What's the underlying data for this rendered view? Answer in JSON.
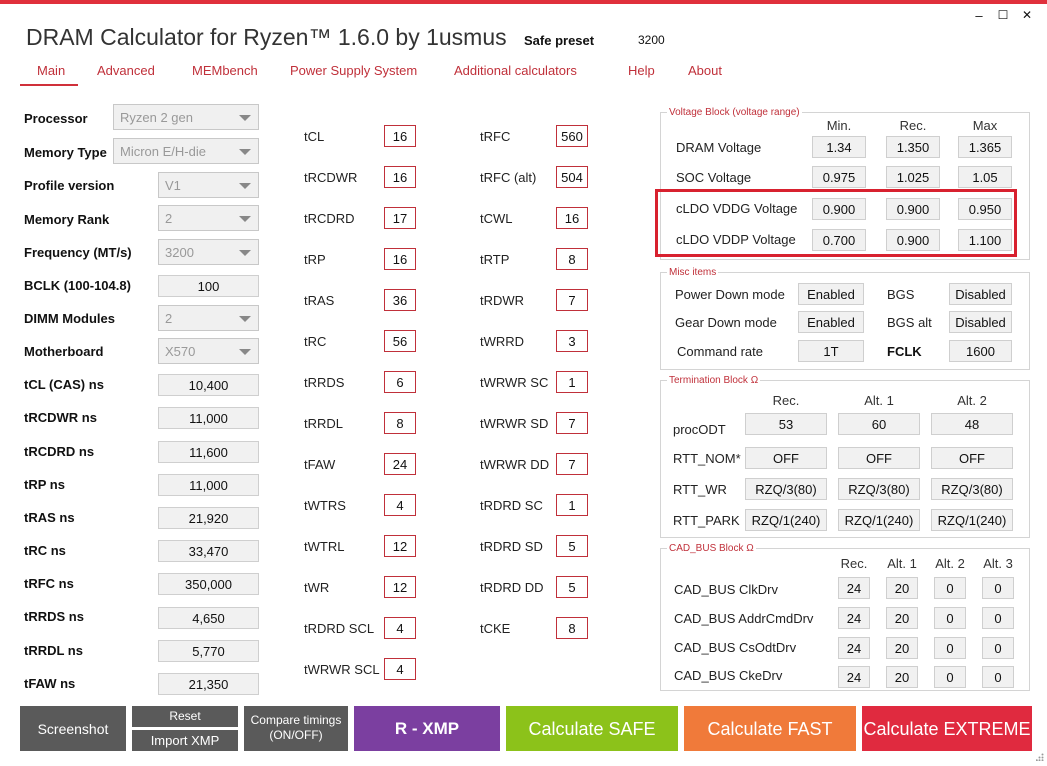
{
  "window": {
    "title": "DRAM Calculator for Ryzen™ 1.6.0 by 1usmus",
    "preset_label": "Safe preset",
    "preset_value": "3200",
    "minimize": "–",
    "maximize": "☐",
    "close": "✕"
  },
  "menu": [
    "Main",
    "Advanced",
    "MEMbench",
    "Power Supply System",
    "Additional calculators",
    "Help",
    "About"
  ],
  "settings": [
    {
      "label": "Processor",
      "value": "Ryzen 2 gen"
    },
    {
      "label": "Memory Type",
      "value": "Micron E/H-die"
    },
    {
      "label": "Profile version",
      "value": "V1"
    },
    {
      "label": "Memory Rank",
      "value": "2"
    },
    {
      "label": "Frequency (MT/s)",
      "value": "3200"
    },
    {
      "label": "BCLK (100-104.8)",
      "value": "100"
    },
    {
      "label": "DIMM Modules",
      "value": "2"
    },
    {
      "label": "Motherboard",
      "value": "X570"
    }
  ],
  "ns_values": [
    {
      "label": "tCL (CAS) ns",
      "value": "10,400"
    },
    {
      "label": "tRCDWR ns",
      "value": "11,000"
    },
    {
      "label": "tRCDRD ns",
      "value": "11,600"
    },
    {
      "label": "tRP ns",
      "value": "11,000"
    },
    {
      "label": "tRAS ns",
      "value": "21,920"
    },
    {
      "label": "tRC ns",
      "value": "33,470"
    },
    {
      "label": "tRFC ns",
      "value": "350,000"
    },
    {
      "label": "tRRDS ns",
      "value": "4,650"
    },
    {
      "label": "tRRDL ns",
      "value": "5,770"
    },
    {
      "label": "tFAW ns",
      "value": "21,350"
    }
  ],
  "timings_left": [
    {
      "label": "tCL",
      "value": "16"
    },
    {
      "label": "tRCDWR",
      "value": "16"
    },
    {
      "label": "tRCDRD",
      "value": "17"
    },
    {
      "label": "tRP",
      "value": "16"
    },
    {
      "label": "tRAS",
      "value": "36"
    },
    {
      "label": "tRC",
      "value": "56"
    },
    {
      "label": "tRRDS",
      "value": "6"
    },
    {
      "label": "tRRDL",
      "value": "8"
    },
    {
      "label": "tFAW",
      "value": "24"
    },
    {
      "label": "tWTRS",
      "value": "4"
    },
    {
      "label": "tWTRL",
      "value": "12"
    },
    {
      "label": "tWR",
      "value": "12"
    },
    {
      "label": "tRDRD SCL",
      "value": "4"
    },
    {
      "label": "tWRWR SCL",
      "value": "4"
    }
  ],
  "timings_right": [
    {
      "label": "tRFC",
      "value": "560"
    },
    {
      "label": "tRFC (alt)",
      "value": "504"
    },
    {
      "label": "tCWL",
      "value": "16"
    },
    {
      "label": "tRTP",
      "value": "8"
    },
    {
      "label": "tRDWR",
      "value": "7"
    },
    {
      "label": "tWRRD",
      "value": "3"
    },
    {
      "label": "tWRWR SC",
      "value": "1"
    },
    {
      "label": "tWRWR SD",
      "value": "7"
    },
    {
      "label": "tWRWR DD",
      "value": "7"
    },
    {
      "label": "tRDRD SC",
      "value": "1"
    },
    {
      "label": "tRDRD SD",
      "value": "5"
    },
    {
      "label": "tRDRD DD",
      "value": "5"
    },
    {
      "label": "tCKE",
      "value": "8"
    }
  ],
  "voltage": {
    "title": "Voltage Block (voltage range)",
    "headers": [
      "Min.",
      "Rec.",
      "Max"
    ],
    "rows": [
      {
        "label": "DRAM Voltage",
        "values": [
          "1.34",
          "1.350",
          "1.365"
        ]
      },
      {
        "label": "SOC Voltage",
        "values": [
          "0.975",
          "1.025",
          "1.05"
        ]
      },
      {
        "label": "cLDO VDDG Voltage",
        "values": [
          "0.900",
          "0.900",
          "0.950"
        ]
      },
      {
        "label": "cLDO VDDP Voltage",
        "values": [
          "0.700",
          "0.900",
          "1.100"
        ]
      }
    ]
  },
  "misc": {
    "title": "Misc items",
    "rows": [
      {
        "label": "Power Down mode",
        "value": "Enabled",
        "label2": "BGS",
        "value2": "Disabled"
      },
      {
        "label": "Gear Down mode",
        "value": "Enabled",
        "label2": "BGS alt",
        "value2": "Disabled"
      },
      {
        "label": "Command rate",
        "value": "1T",
        "label2": "FCLK",
        "value2": "1600"
      }
    ]
  },
  "termination": {
    "title": "Termination Block Ω",
    "headers": [
      "Rec.",
      "Alt. 1",
      "Alt. 2"
    ],
    "rows": [
      {
        "label": "procODT",
        "values": [
          "53",
          "60",
          "48"
        ]
      },
      {
        "label": "RTT_NOM*",
        "values": [
          "OFF",
          "OFF",
          "OFF"
        ]
      },
      {
        "label": "RTT_WR",
        "values": [
          "RZQ/3(80)",
          "RZQ/3(80)",
          "RZQ/3(80)"
        ]
      },
      {
        "label": "RTT_PARK",
        "values": [
          "RZQ/1(240)",
          "RZQ/1(240)",
          "RZQ/1(240)"
        ]
      }
    ]
  },
  "cadbus": {
    "title": "CAD_BUS Block Ω",
    "headers": [
      "Rec.",
      "Alt. 1",
      "Alt. 2",
      "Alt. 3"
    ],
    "rows": [
      {
        "label": "CAD_BUS ClkDrv",
        "values": [
          "24",
          "20",
          "0",
          "0"
        ]
      },
      {
        "label": "CAD_BUS AddrCmdDrv",
        "values": [
          "24",
          "20",
          "0",
          "0"
        ]
      },
      {
        "label": "CAD_BUS CsOdtDrv",
        "values": [
          "24",
          "20",
          "0",
          "0"
        ]
      },
      {
        "label": "CAD_BUS CkeDrv",
        "values": [
          "24",
          "20",
          "0",
          "0"
        ]
      }
    ]
  },
  "buttons": {
    "screenshot": "Screenshot",
    "reset": "Reset",
    "import_xmp": "Import XMP",
    "compare_line1": "Compare timings",
    "compare_line2": "(ON/OFF)",
    "rxmp": "R - XMP",
    "safe": "Calculate SAFE",
    "fast": "Calculate FAST",
    "extreme": "Calculate EXTREME"
  },
  "colors": {
    "accent": "#e0303c",
    "safe": "#8cc21a",
    "fast": "#f07a3a",
    "extreme": "#e02a3f",
    "rxmp": "#7b3fa0",
    "dark_button": "#5a5a5a"
  }
}
